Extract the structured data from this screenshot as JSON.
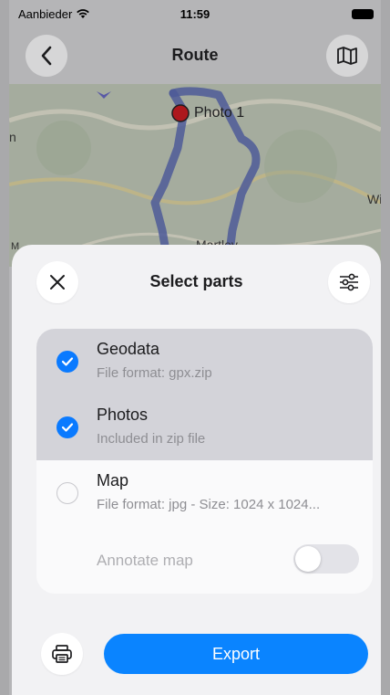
{
  "status_bar": {
    "carrier": "Aanbieder",
    "time": "11:59"
  },
  "nav": {
    "title": "Route",
    "back_icon": "chevron-left-icon",
    "map_icon": "map-icon"
  },
  "map": {
    "labels": {
      "photo": "Photo 1",
      "town": "Martley",
      "right_edge": "Wic",
      "left_edge": "n",
      "attribution_fragment": "M"
    },
    "route_color": "#5462a8",
    "marker_color": "#c0161c"
  },
  "sheet": {
    "title": "Select parts",
    "options": [
      {
        "name": "Geodata",
        "subtitle": "File format: gpx.zip",
        "selected": true
      },
      {
        "name": "Photos",
        "subtitle": "Included in zip file",
        "selected": true
      },
      {
        "name": "Map",
        "subtitle": "File format: jpg - Size: 1024 x 1024...",
        "selected": false
      }
    ],
    "annotate_label": "Annotate map",
    "annotate_enabled": false,
    "export_label": "Export"
  },
  "colors": {
    "accent": "#0a84ff",
    "check": "#0a7aff",
    "selected_row": "#d3d3d9"
  }
}
